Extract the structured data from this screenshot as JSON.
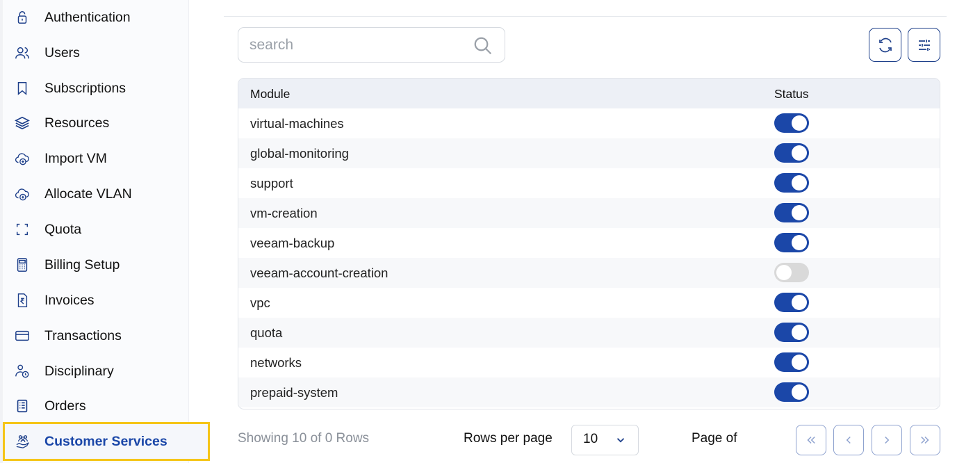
{
  "sidebar": {
    "items": [
      {
        "label": "Authentication",
        "icon": "lock-icon"
      },
      {
        "label": "Users",
        "icon": "users-icon"
      },
      {
        "label": "Subscriptions",
        "icon": "bookmark-icon"
      },
      {
        "label": "Resources",
        "icon": "layers-icon"
      },
      {
        "label": "Import VM",
        "icon": "cloud-add-icon"
      },
      {
        "label": "Allocate VLAN",
        "icon": "cloud-add-icon"
      },
      {
        "label": "Quota",
        "icon": "frame-icon"
      },
      {
        "label": "Billing Setup",
        "icon": "calculator-icon"
      },
      {
        "label": "Invoices",
        "icon": "rupee-document-icon"
      },
      {
        "label": "Transactions",
        "icon": "card-icon"
      },
      {
        "label": "Disciplinary",
        "icon": "user-clock-icon"
      },
      {
        "label": "Orders",
        "icon": "receipt-icon"
      },
      {
        "label": "Customer Services",
        "icon": "customer-hand-icon",
        "active": true
      }
    ]
  },
  "search": {
    "placeholder": "search"
  },
  "toolbar": {
    "refresh_icon": "refresh-icon",
    "filter_icon": "sliders-icon"
  },
  "table": {
    "headers": {
      "module": "Module",
      "status": "Status"
    },
    "rows": [
      {
        "module": "virtual-machines",
        "enabled": true
      },
      {
        "module": "global-monitoring",
        "enabled": true
      },
      {
        "module": "support",
        "enabled": true
      },
      {
        "module": "vm-creation",
        "enabled": true
      },
      {
        "module": "veeam-backup",
        "enabled": true
      },
      {
        "module": "veeam-account-creation",
        "enabled": false
      },
      {
        "module": "vpc",
        "enabled": true
      },
      {
        "module": "quota",
        "enabled": true
      },
      {
        "module": "networks",
        "enabled": true
      },
      {
        "module": "prepaid-system",
        "enabled": true
      }
    ]
  },
  "footer": {
    "showing": "Showing 10 of 0 Rows",
    "rows_per_page_label": "Rows per page",
    "rows_per_page_value": "10",
    "page_of": "Page of"
  },
  "colors": {
    "accent": "#1b47a8",
    "highlight_border": "#f5c518",
    "toggle_off": "#d9d9d9"
  }
}
